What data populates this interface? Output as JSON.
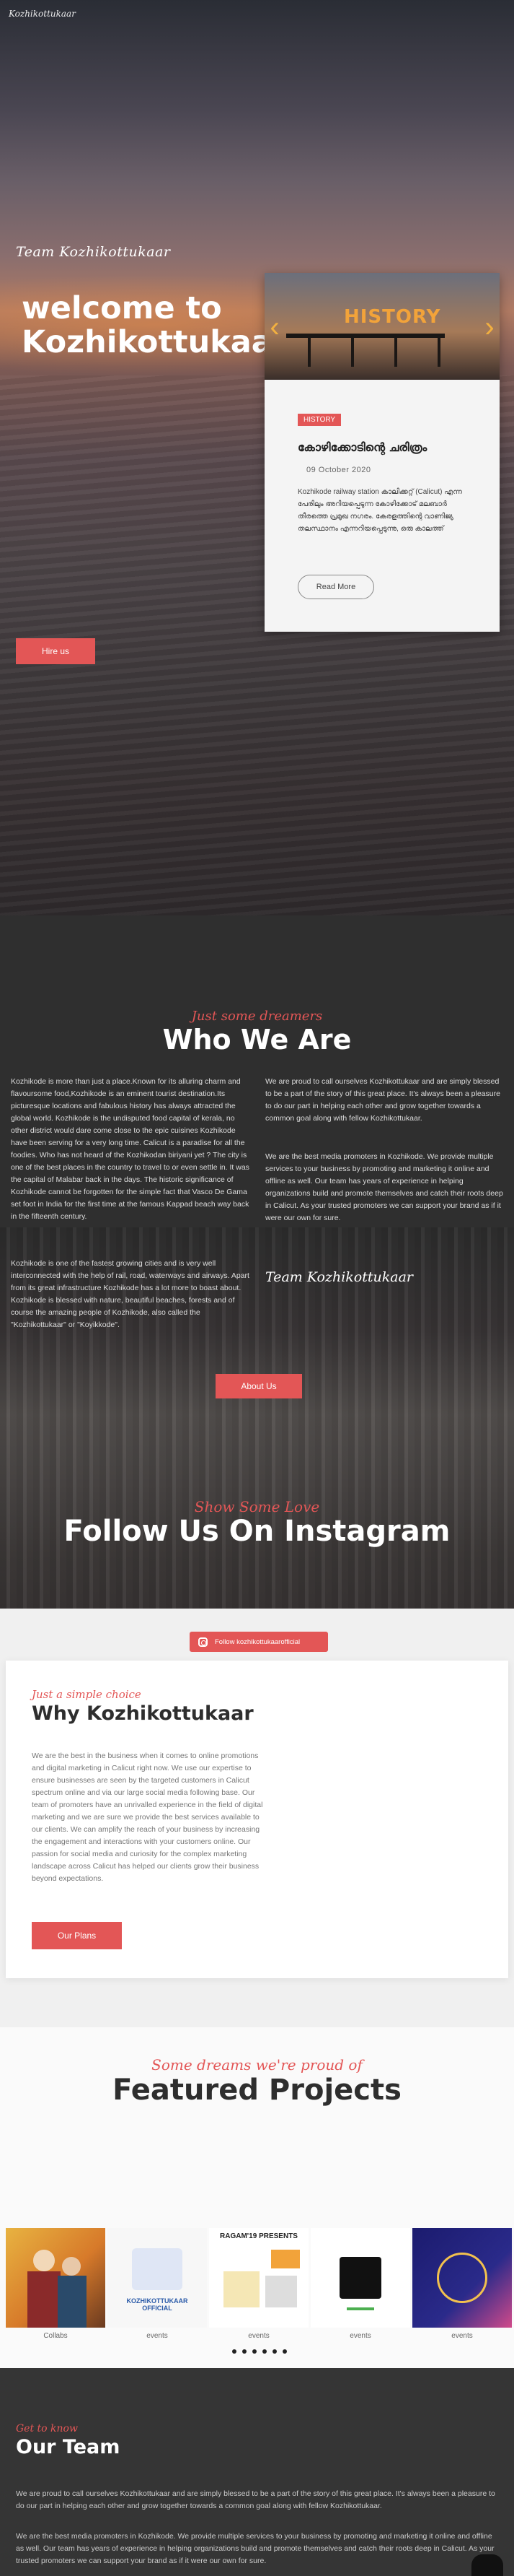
{
  "hero": {
    "nav_logo": "Kozhikottukaar",
    "team_script": "Team Kozhikottukaar",
    "welcome": "welcome to Kozhikottukaar...",
    "hire_button": "Hire us"
  },
  "post_card": {
    "image_overlay": "HISTORY",
    "category": "HISTORY",
    "title": "കോഴിക്കോടിന്റെ ചരിത്രം",
    "date": "09 October 2020",
    "excerpt": "Kozhikode railway station കാലിക്കറ്റ് (Calicut) എന്ന പേരിലും അറിയപ്പെടുന്ന കോഴിക്കോട് മലബാർ തീരത്തെ പ്രമുഖ നഗരം. കേരളത്തിന്റെ വാണിജ്യ തലസ്ഥാനം എന്നറിയപ്പെടുന്നു, ഒരു കാലത്ത്",
    "read_more": "Read More"
  },
  "who": {
    "subtitle": "Just some dreamers",
    "title": "Who We Are",
    "left_p1": "Kozhikode is more than just a place.Known for its alluring charm and flavoursome food,Kozhikode is an eminent tourist destination.Its picturesque locations and fabulous history has always attracted the global world. Kozhikode is the undisputed food capital of kerala, no other district would dare come close to the epic cuisines Kozhikode have been serving for a very long time. Calicut is a paradise for all the foodies. Who has not heard of the Kozhikodan biriyani yet ? The city is one of the best places in the country to travel to or even settle in. It was the capital of Malabar back in the days. The historic significance of Kozhikode cannot be forgotten for the simple fact that Vasco De Gama set foot in India for the first time at the famous Kappad beach way back in the fifteenth century.",
    "left_p2": "Kozhikode is one of the fastest growing cities and is very well interconnected with the help of rail, road, waterways and airways. Apart from its great infrastructure Kozhikode has a lot more to boast about. Kozhikode is blessed with nature, beautiful beaches, forests and of course the amazing people of Kozhikode, also called the \"Kozhikottukaar\" or \"Koyikkode\".",
    "right_p1": "We are proud to call ourselves Kozhikottukaar and are simply blessed to be a part of the story of this great place. It's always been a pleasure to do our part in helping each other and grow together towards a common goal along with fellow Kozhikottukaar.",
    "right_p2": "We are the best media promoters in Kozhikode. We provide multiple services to your business by promoting and marketing it online and offline as well. Our team has years of experience in helping organizations build and promote themselves and catch their roots deep in Calicut. As your trusted promoters we can support your brand as if it were our own for sure.",
    "signature": "Team Kozhikottukaar",
    "about_button": "About Us"
  },
  "instagram": {
    "subtitle": "Show Some Love",
    "title": "Follow Us On Instagram",
    "follow_button": "Follow kozhikottukaarofficial"
  },
  "why": {
    "subtitle": "Just a simple choice",
    "title": "Why Kozhikottukaar",
    "text": "We are the best in the business when it comes to online promotions and digital marketing in Calicut right now. We use our expertise to ensure businesses are seen by the targeted customers in Calicut spectrum online and via our large social media following base. Our team of promoters have an unrivalled experience in the field of digital marketing and we are sure we provide the best services available to our clients. We can amplify the reach of your business by increasing the engagement and interactions with your customers online. Our passion for social media and curiosity for the complex marketing landscape across Calicut has helped our clients grow their business beyond expectations.",
    "plans_button": "Our Plans"
  },
  "featured": {
    "subtitle": "Some dreams we're proud of",
    "title": "Featured Projects",
    "projects": [
      {
        "label": "Collabs"
      },
      {
        "label": "events",
        "caption": "KOZHIKOTTUKAAR OFFICIAL"
      },
      {
        "label": "events",
        "caption": "RAGAM'19 PRESENTS"
      },
      {
        "label": "events"
      },
      {
        "label": "events"
      }
    ]
  },
  "team": {
    "subtitle": "Get to know",
    "title": "Our Team",
    "p1": "We are proud to call ourselves Kozhikottukaar and are simply blessed to be a part of the story of this great place. It's always been a pleasure to do our part in helping each other and grow together towards a common goal along with fellow Kozhikottukaar.",
    "p2": "We are the best media promoters in Kozhikode. We provide multiple services to your business by promoting and marketing it online and offline as well. Our team has years of experience in helping organizations build and promote themselves and catch their roots deep in Calicut. As your trusted promoters we can support your brand as if it were our own for sure."
  },
  "colors": {
    "accent": "#e35656",
    "dark": "#2e2e2e",
    "light": "#f0f0f0"
  }
}
